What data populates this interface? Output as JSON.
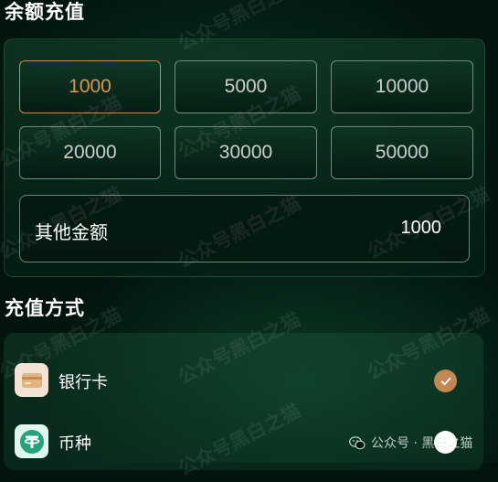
{
  "recharge": {
    "title": "余额充值",
    "amounts": [
      {
        "label": "1000",
        "selected": true
      },
      {
        "label": "5000",
        "selected": false
      },
      {
        "label": "10000",
        "selected": false
      },
      {
        "label": "20000",
        "selected": false
      },
      {
        "label": "30000",
        "selected": false
      },
      {
        "label": "50000",
        "selected": false
      }
    ],
    "custom": {
      "label": "其他金额",
      "value": "1000"
    }
  },
  "payment": {
    "title": "充值方式",
    "methods": [
      {
        "label": "银行卡",
        "icon": "bank-card-icon",
        "checked": true
      },
      {
        "label": "币种",
        "icon": "tether-coin-icon",
        "checked": false
      }
    ]
  },
  "watermark": {
    "text": "公众号黑白之猫",
    "credit": "公众号 · 黑白之猫"
  },
  "colors": {
    "background": "#02140d",
    "selected_accent": "#d99656",
    "check_accent": "#c28755",
    "coin_accent": "#26a17b"
  }
}
